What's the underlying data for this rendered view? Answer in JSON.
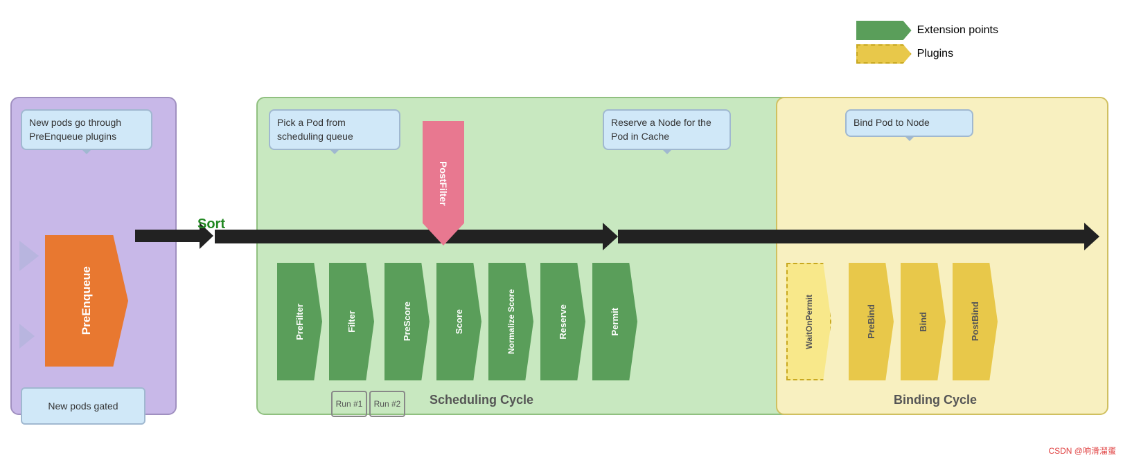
{
  "legend": {
    "extension_points_label": "Extension points",
    "plugins_label": "Plugins"
  },
  "sections": {
    "preenqueue": {
      "bubble_text": "New pods go through PreEnqueue plugins",
      "arrow_label": "PreEnqueue",
      "gated_text": "New pods gated",
      "label": ""
    },
    "scheduling": {
      "label": "Scheduling Cycle",
      "pick_pod_text": "Pick a Pod from scheduling queue",
      "plugins": [
        "PreFilter",
        "Filter",
        "PreScore",
        "Score",
        "Normalize Score",
        "Reserve",
        "Permit"
      ],
      "postfilter_label": "PostFilter",
      "run1": "Run #1",
      "run2": "Run #2"
    },
    "binding": {
      "label": "Binding Cycle",
      "reserve_text": "Reserve a Node for the Pod in Cache",
      "bind_pod_text": "Bind Pod to Node",
      "plugins": [
        "WaitOnPermit",
        "PreBind",
        "Bind",
        "PostBind"
      ]
    }
  },
  "sort_label": "Sort",
  "watermark": "CSDN @响滑溜蛋"
}
